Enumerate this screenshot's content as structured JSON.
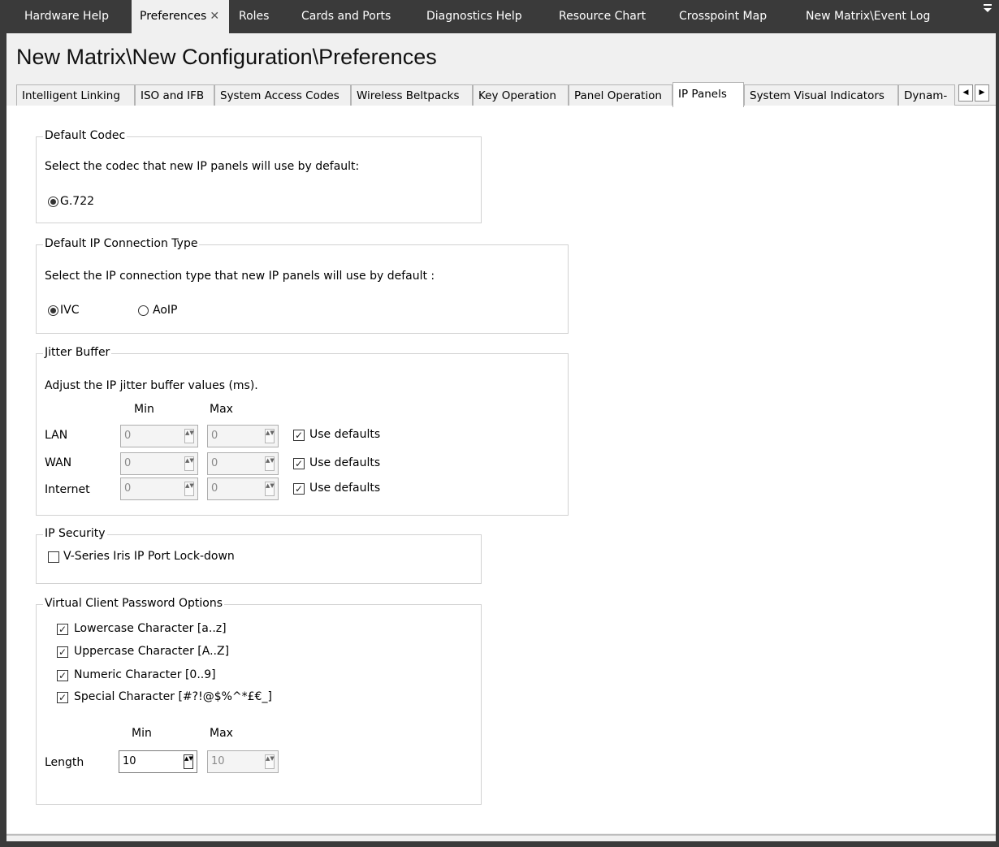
{
  "doc_tabs": [
    {
      "label": "Hardware Help",
      "active": false
    },
    {
      "label": "Preferences",
      "active": true,
      "close": "✕"
    },
    {
      "label": "Roles",
      "active": false
    },
    {
      "label": "Cards and Ports",
      "active": false
    },
    {
      "label": "Diagnostics Help",
      "active": false
    },
    {
      "label": "Resource Chart",
      "active": false
    },
    {
      "label": "Crosspoint Map",
      "active": false
    },
    {
      "label": "New Matrix\\Event Log",
      "active": false
    }
  ],
  "overflow_icon": "overflow-menu-icon",
  "page_title": "New Matrix\\New Configuration\\Preferences",
  "pref_tabs": [
    {
      "label": "Intelligent Linking"
    },
    {
      "label": "ISO and IFB"
    },
    {
      "label": "System Access Codes"
    },
    {
      "label": "Wireless Beltpacks"
    },
    {
      "label": "Key Operation"
    },
    {
      "label": "Panel Operation"
    },
    {
      "label": "IP Panels",
      "active": true
    },
    {
      "label": "System Visual Indicators"
    },
    {
      "label": "Dynam-"
    }
  ],
  "default_codec": {
    "title": "Default Codec",
    "description": "Select the codec that new IP panels will use by default:",
    "option": "G.722",
    "selected": true
  },
  "connection_type": {
    "title": "Default IP Connection Type",
    "description": "Select the IP connection type that new IP panels will use by default :",
    "options": [
      {
        "label": "IVC",
        "selected": true
      },
      {
        "label": "AoIP",
        "selected": false
      }
    ]
  },
  "jitter": {
    "title": "Jitter Buffer",
    "description": "Adjust the IP jitter buffer values (ms).",
    "min_header": "Min",
    "max_header": "Max",
    "rows": [
      {
        "label": "LAN",
        "min": "0",
        "max": "0",
        "use_defaults_label": "Use defaults",
        "use_defaults": true
      },
      {
        "label": "WAN",
        "min": "0",
        "max": "0",
        "use_defaults_label": "Use defaults",
        "use_defaults": true
      },
      {
        "label": "Internet",
        "min": "0",
        "max": "0",
        "use_defaults_label": "Use defaults",
        "use_defaults": true
      }
    ]
  },
  "ip_security": {
    "title": "IP Security",
    "lockdown_label": "V-Series Iris IP Port Lock-down",
    "lockdown": false
  },
  "password": {
    "title": "Virtual Client Password Options",
    "options": [
      {
        "label": "Lowercase Character [a..z]",
        "checked": true
      },
      {
        "label": "Uppercase Character [A..Z]",
        "checked": true
      },
      {
        "label": "Numeric Character [0..9]",
        "checked": true
      },
      {
        "label": "Special Character [#?!@$%^*£€_]",
        "checked": true
      }
    ],
    "min_header": "Min",
    "max_header": "Max",
    "length_label": "Length",
    "length_min": "10",
    "length_max": "10"
  },
  "check_glyph": "✓",
  "spin_glyph": "▲▼"
}
